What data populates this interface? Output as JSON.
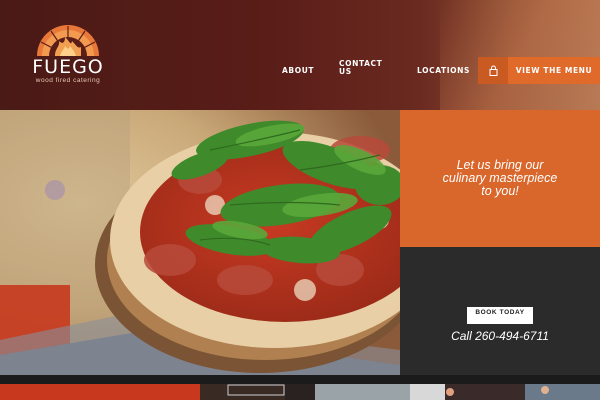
{
  "logo": {
    "name": "FUEGO",
    "tagline": "wood fired catering"
  },
  "nav": {
    "about": "ABOUT",
    "contact": "CONTACT US",
    "locations": "LOCATIONS",
    "menu_button": "VIEW THE MENU",
    "lock_icon": "lock-icon"
  },
  "promo": {
    "text": "Let us bring our culinary masterpiece to you!"
  },
  "booking": {
    "button": "BOOK TODAY",
    "phone": "Call 260-494-6711"
  },
  "colors": {
    "accent_orange": "#d9662a",
    "header_maroon": "#4a1a16",
    "dark_panel": "#2b2b2b"
  }
}
